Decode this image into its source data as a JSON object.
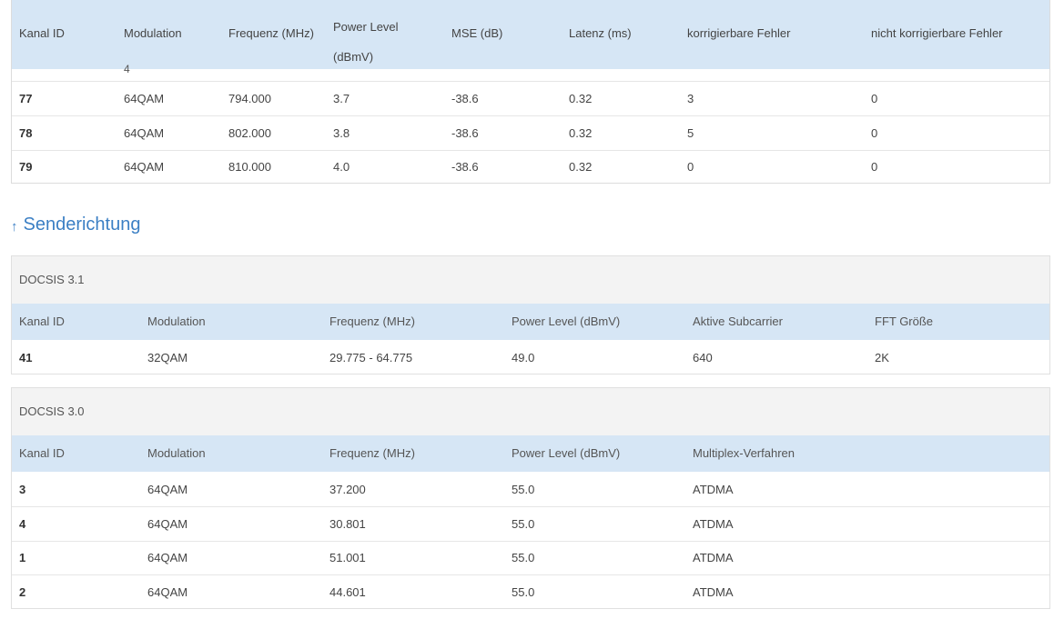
{
  "downstream": {
    "headers": [
      "Kanal ID",
      "Modulation",
      "Frequenz (MHz)",
      "Power Level (dBmV)",
      "MSE (dB)",
      "Latenz (ms)",
      "korrigierbare Fehler",
      "nicht korrigierbare Fehler"
    ],
    "peek_text": "4",
    "rows": [
      [
        "77",
        "64QAM",
        "794.000",
        "3.7",
        "-38.6",
        "0.32",
        "3",
        "0"
      ],
      [
        "78",
        "64QAM",
        "802.000",
        "3.8",
        "-38.6",
        "0.32",
        "5",
        "0"
      ],
      [
        "79",
        "64QAM",
        "810.000",
        "4.0",
        "-38.6",
        "0.32",
        "0",
        "0"
      ]
    ]
  },
  "upstream": {
    "title": "Senderichtung",
    "arrow": "↑",
    "docsis31": {
      "caption": "DOCSIS 3.1",
      "headers": [
        "Kanal ID",
        "Modulation",
        "Frequenz (MHz)",
        "Power Level (dBmV)",
        "Aktive Subcarrier",
        "FFT Größe"
      ],
      "rows": [
        [
          "41",
          "32QAM",
          "29.775 - 64.775",
          "49.0",
          "640",
          "2K"
        ]
      ]
    },
    "docsis30": {
      "caption": "DOCSIS 3.0",
      "headers": [
        "Kanal ID",
        "Modulation",
        "Frequenz (MHz)",
        "Power Level (dBmV)",
        "Multiplex-Verfahren"
      ],
      "rows": [
        [
          "3",
          "64QAM",
          "37.200",
          "55.0",
          "ATDMA"
        ],
        [
          "4",
          "64QAM",
          "30.801",
          "55.0",
          "ATDMA"
        ],
        [
          "1",
          "64QAM",
          "51.001",
          "55.0",
          "ATDMA"
        ],
        [
          "2",
          "64QAM",
          "44.601",
          "55.0",
          "ATDMA"
        ]
      ]
    }
  }
}
